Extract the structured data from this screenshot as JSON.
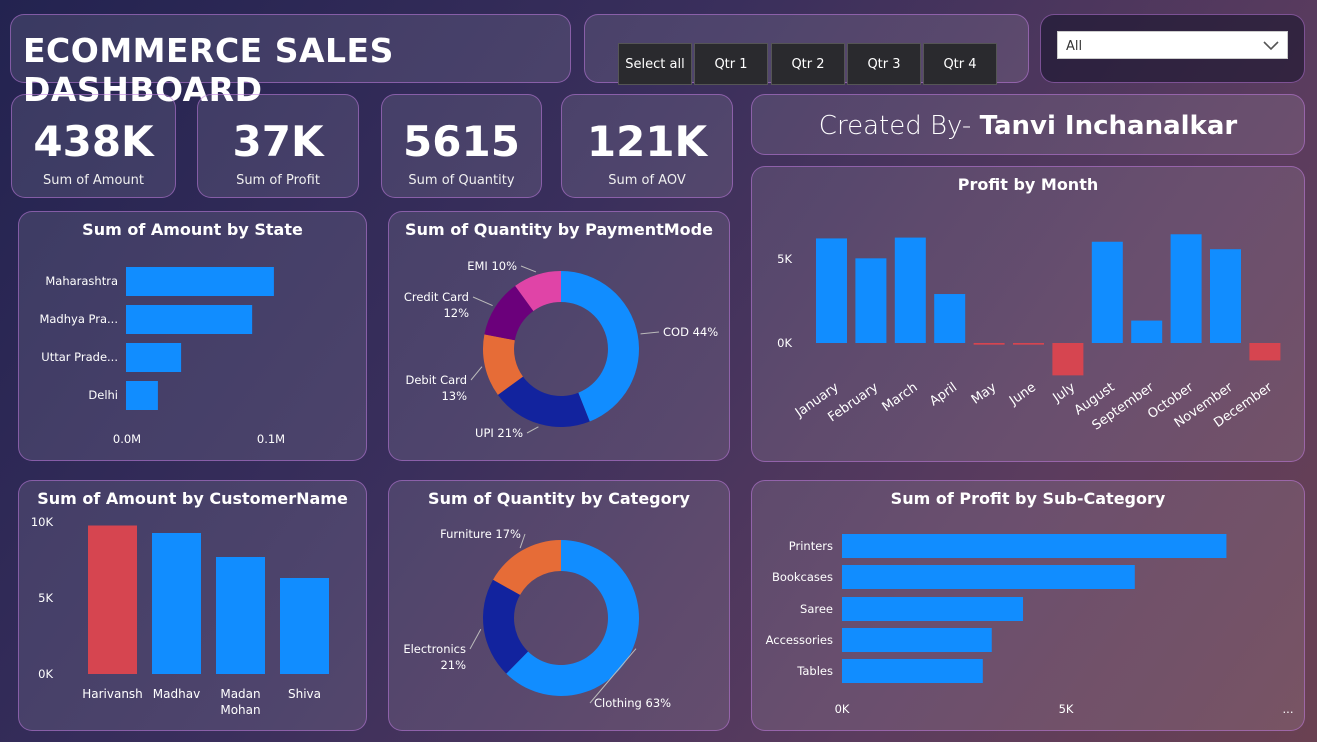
{
  "header": {
    "title": "ECOMMERCE SALES DASHBOARD"
  },
  "slicer": {
    "buttons": [
      "Select all",
      "Qtr 1",
      "Qtr 2",
      "Qtr 3",
      "Qtr 4"
    ]
  },
  "filter": {
    "value": "All"
  },
  "kpis": [
    {
      "value": "438K",
      "label": "Sum of Amount"
    },
    {
      "value": "37K",
      "label": "Sum of Profit"
    },
    {
      "value": "5615",
      "label": "Sum of Quantity"
    },
    {
      "value": "121K",
      "label": "Sum of AOV"
    }
  ],
  "credit": {
    "prefix": "Created By- ",
    "name": "Tanvi Inchanalkar"
  },
  "colors": {
    "blue": "#118dff",
    "red": "#d64550",
    "navy": "#12239e",
    "orange": "#e66c37",
    "purple": "#6b007b",
    "pink": "#e044a7"
  },
  "chart_data": [
    {
      "id": "state",
      "type": "bar",
      "orientation": "horizontal",
      "title": "Sum of Amount by State",
      "categories": [
        "Maharashtra",
        "Madhya Pra...",
        "Uttar Prade...",
        "Delhi"
      ],
      "values": [
        102000,
        87000,
        38000,
        22000
      ],
      "xticks": [
        "0.0M",
        "0.1M"
      ],
      "xlim": [
        0,
        0.1
      ]
    },
    {
      "id": "payment",
      "type": "pie",
      "title": "Sum of Quantity by PaymentMode",
      "slices": [
        {
          "label": "COD 44%",
          "value": 44
        },
        {
          "label": "UPI 21%",
          "value": 21
        },
        {
          "label": "Debit Card 13%",
          "value": 13
        },
        {
          "label": "Credit Card 12%",
          "value": 12
        },
        {
          "label": "EMI 10%",
          "value": 10
        }
      ]
    },
    {
      "id": "month",
      "type": "bar",
      "title": "Profit by Month",
      "categories": [
        "January",
        "February",
        "March",
        "April",
        "May",
        "June",
        "July",
        "August",
        "September",
        "October",
        "November",
        "December"
      ],
      "values": [
        6300,
        5100,
        6350,
        2950,
        -100,
        -100,
        -1950,
        6100,
        1350,
        6550,
        5650,
        -1050
      ],
      "yticks": [
        "5K",
        "0K"
      ],
      "ylim": [
        -2500,
        7500
      ]
    },
    {
      "id": "customer",
      "type": "bar",
      "title": "Sum of Amount by CustomerName",
      "categories": [
        "Harivansh",
        "Madhav",
        "Madan Mohan",
        "Shiva"
      ],
      "values": [
        9900,
        9400,
        7800,
        6400
      ],
      "yticks": [
        "10K",
        "5K",
        "0K"
      ],
      "ylim": [
        0,
        10000
      ]
    },
    {
      "id": "category",
      "type": "pie",
      "title": "Sum of Quantity by Category",
      "slices": [
        {
          "label": "Clothing 63%",
          "value": 63
        },
        {
          "label": "Electronics 21%",
          "value": 21
        },
        {
          "label": "Furniture 17%",
          "value": 17
        }
      ]
    },
    {
      "id": "subcat",
      "type": "bar",
      "orientation": "horizontal",
      "title": "Sum of Profit by Sub-Category",
      "categories": [
        "Printers",
        "Bookcases",
        "Saree",
        "Accessories",
        "Tables"
      ],
      "values": [
        8600,
        6550,
        4050,
        3350,
        3150
      ],
      "xticks": [
        "0K",
        "5K"
      ],
      "xlim": [
        0,
        10000
      ],
      "more_indicator": "..."
    }
  ]
}
